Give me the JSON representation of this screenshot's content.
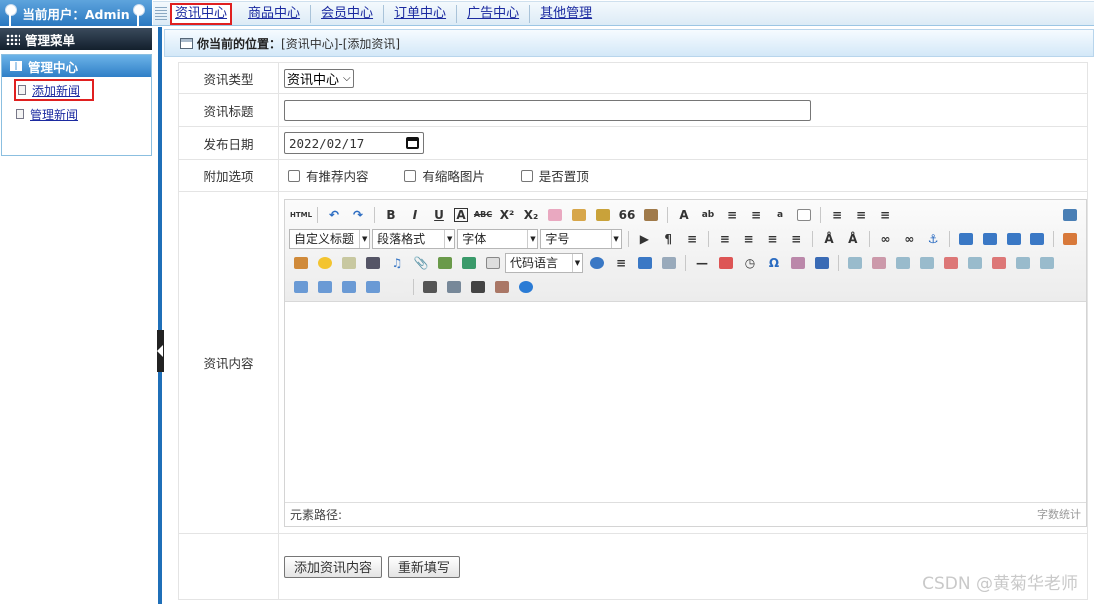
{
  "header": {
    "current_user": "当前用户：Admin",
    "nav": [
      "资讯中心",
      "商品中心",
      "会员中心",
      "订单中心",
      "广告中心",
      "其他管理"
    ]
  },
  "sidebar": {
    "menu_title": "管理菜单",
    "section_title": "管理中心",
    "items": [
      "添加新闻",
      "管理新闻"
    ]
  },
  "breadcrumb": {
    "label": "你当前的位置：",
    "path": "[资讯中心]-[添加资讯]"
  },
  "form": {
    "type_label": "资讯类型",
    "type_value": "资讯中心",
    "title_label": "资讯标题",
    "title_value": "",
    "date_label": "发布日期",
    "date_value": "2022/02/17",
    "options_label": "附加选项",
    "options": [
      "有推荐内容",
      "有缩略图片",
      "是否置顶"
    ],
    "content_label": "资讯内容"
  },
  "editor": {
    "combos": [
      "自定义标题",
      "段落格式",
      "字体",
      "字号",
      "代码语言"
    ],
    "element_path": "元素路径:",
    "word_count": "字数统计"
  },
  "buttons": {
    "submit": "添加资讯内容",
    "reset": "重新填写"
  },
  "watermark": "CSDN @黄菊华老师"
}
